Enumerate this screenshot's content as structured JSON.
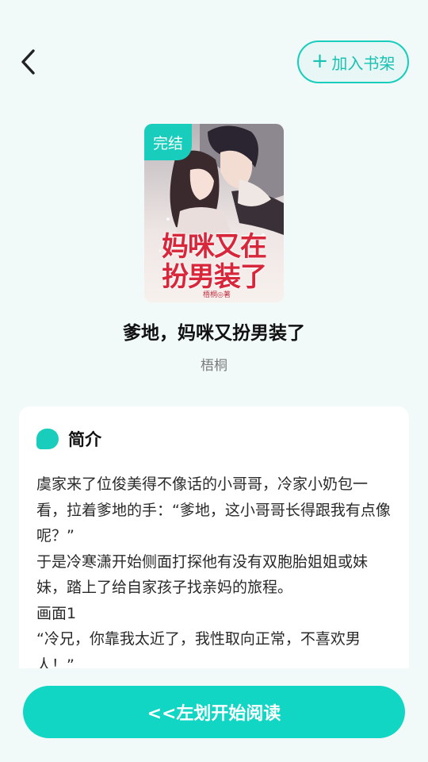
{
  "header": {
    "back_icon": "chevron-left-icon",
    "add_shelf_label": "加入书架",
    "add_shelf_icon": "plus-icon",
    "accent_color": "#19cdbc"
  },
  "book": {
    "status_badge": "完结",
    "cover_title_line1": "妈咪又在",
    "cover_title_line2": "扮男装了",
    "cover_author": "梧桐◎著",
    "title": "爹地，妈咪又扮男装了",
    "author": "梧桐"
  },
  "intro": {
    "label": "简介",
    "lines": [
      "虞家来了位俊美得不像话的小哥哥，冷家小奶包一看，拉着爹地的手：“爹地，这小哥哥长得跟我有点像呢？”",
      "于是冷寒潇开始侧面打探他有没有双胞胎姐姐或妹妹，踏上了给自家孩子找亲妈的旅程。",
      "画面1",
      "“冷兄，你靠我太近了，我性取向正常，不喜欢男人！”"
    ]
  },
  "footer": {
    "read_button_label": "<<左划开始阅读"
  }
}
